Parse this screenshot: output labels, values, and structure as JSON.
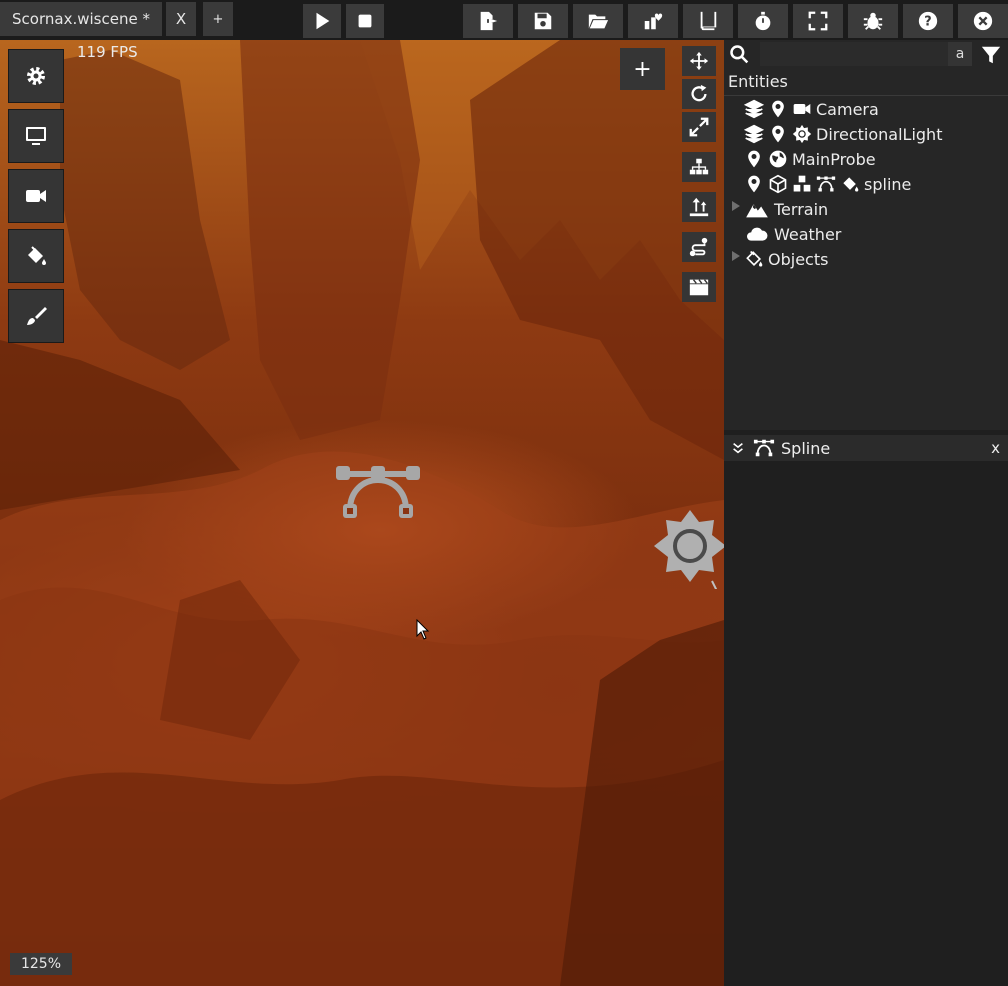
{
  "tabs": [
    {
      "label": "Scornax.wiscene *"
    },
    {
      "label": "X"
    },
    {
      "label": "+"
    }
  ],
  "viewport": {
    "fps": "119 FPS",
    "zoom": "125%",
    "add_label": "+"
  },
  "toolbar_icons": [
    "play-icon",
    "stop-icon",
    "export-icon",
    "save-icon",
    "open-folder-icon",
    "content-browser-icon",
    "backlog-icon",
    "profiler-icon",
    "fullscreen-icon",
    "bug-icon",
    "help-icon",
    "exit-icon"
  ],
  "entities": {
    "title": "Entities",
    "search_placeholder": "",
    "search_option": "a",
    "items": [
      {
        "label": "Camera"
      },
      {
        "label": "DirectionalLight"
      },
      {
        "label": "MainProbe"
      },
      {
        "label": "spline"
      },
      {
        "label": "Terrain"
      },
      {
        "label": "Weather"
      },
      {
        "label": "Objects"
      }
    ]
  },
  "component": {
    "title": "Spline",
    "close_label": "x"
  }
}
